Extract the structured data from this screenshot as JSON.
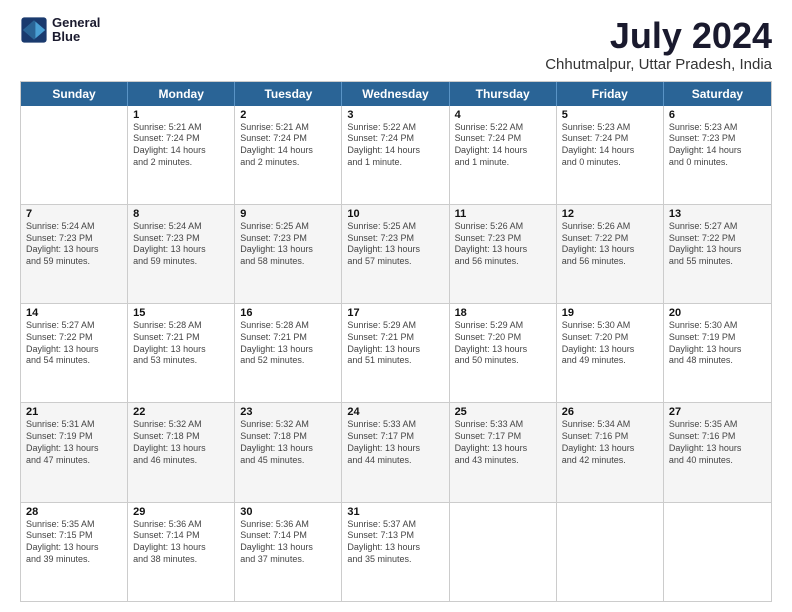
{
  "header": {
    "logo": {
      "line1": "General",
      "line2": "Blue"
    },
    "title": "July 2024",
    "subtitle": "Chhutmalpur, Uttar Pradesh, India"
  },
  "calendar": {
    "days_of_week": [
      "Sunday",
      "Monday",
      "Tuesday",
      "Wednesday",
      "Thursday",
      "Friday",
      "Saturday"
    ],
    "rows": [
      {
        "cells": [
          {
            "day": "",
            "info": ""
          },
          {
            "day": "1",
            "info": "Sunrise: 5:21 AM\nSunset: 7:24 PM\nDaylight: 14 hours\nand 2 minutes."
          },
          {
            "day": "2",
            "info": "Sunrise: 5:21 AM\nSunset: 7:24 PM\nDaylight: 14 hours\nand 2 minutes."
          },
          {
            "day": "3",
            "info": "Sunrise: 5:22 AM\nSunset: 7:24 PM\nDaylight: 14 hours\nand 1 minute."
          },
          {
            "day": "4",
            "info": "Sunrise: 5:22 AM\nSunset: 7:24 PM\nDaylight: 14 hours\nand 1 minute."
          },
          {
            "day": "5",
            "info": "Sunrise: 5:23 AM\nSunset: 7:24 PM\nDaylight: 14 hours\nand 0 minutes."
          },
          {
            "day": "6",
            "info": "Sunrise: 5:23 AM\nSunset: 7:23 PM\nDaylight: 14 hours\nand 0 minutes."
          }
        ]
      },
      {
        "cells": [
          {
            "day": "7",
            "info": "Sunrise: 5:24 AM\nSunset: 7:23 PM\nDaylight: 13 hours\nand 59 minutes."
          },
          {
            "day": "8",
            "info": "Sunrise: 5:24 AM\nSunset: 7:23 PM\nDaylight: 13 hours\nand 59 minutes."
          },
          {
            "day": "9",
            "info": "Sunrise: 5:25 AM\nSunset: 7:23 PM\nDaylight: 13 hours\nand 58 minutes."
          },
          {
            "day": "10",
            "info": "Sunrise: 5:25 AM\nSunset: 7:23 PM\nDaylight: 13 hours\nand 57 minutes."
          },
          {
            "day": "11",
            "info": "Sunrise: 5:26 AM\nSunset: 7:23 PM\nDaylight: 13 hours\nand 56 minutes."
          },
          {
            "day": "12",
            "info": "Sunrise: 5:26 AM\nSunset: 7:22 PM\nDaylight: 13 hours\nand 56 minutes."
          },
          {
            "day": "13",
            "info": "Sunrise: 5:27 AM\nSunset: 7:22 PM\nDaylight: 13 hours\nand 55 minutes."
          }
        ]
      },
      {
        "cells": [
          {
            "day": "14",
            "info": "Sunrise: 5:27 AM\nSunset: 7:22 PM\nDaylight: 13 hours\nand 54 minutes."
          },
          {
            "day": "15",
            "info": "Sunrise: 5:28 AM\nSunset: 7:21 PM\nDaylight: 13 hours\nand 53 minutes."
          },
          {
            "day": "16",
            "info": "Sunrise: 5:28 AM\nSunset: 7:21 PM\nDaylight: 13 hours\nand 52 minutes."
          },
          {
            "day": "17",
            "info": "Sunrise: 5:29 AM\nSunset: 7:21 PM\nDaylight: 13 hours\nand 51 minutes."
          },
          {
            "day": "18",
            "info": "Sunrise: 5:29 AM\nSunset: 7:20 PM\nDaylight: 13 hours\nand 50 minutes."
          },
          {
            "day": "19",
            "info": "Sunrise: 5:30 AM\nSunset: 7:20 PM\nDaylight: 13 hours\nand 49 minutes."
          },
          {
            "day": "20",
            "info": "Sunrise: 5:30 AM\nSunset: 7:19 PM\nDaylight: 13 hours\nand 48 minutes."
          }
        ]
      },
      {
        "cells": [
          {
            "day": "21",
            "info": "Sunrise: 5:31 AM\nSunset: 7:19 PM\nDaylight: 13 hours\nand 47 minutes."
          },
          {
            "day": "22",
            "info": "Sunrise: 5:32 AM\nSunset: 7:18 PM\nDaylight: 13 hours\nand 46 minutes."
          },
          {
            "day": "23",
            "info": "Sunrise: 5:32 AM\nSunset: 7:18 PM\nDaylight: 13 hours\nand 45 minutes."
          },
          {
            "day": "24",
            "info": "Sunrise: 5:33 AM\nSunset: 7:17 PM\nDaylight: 13 hours\nand 44 minutes."
          },
          {
            "day": "25",
            "info": "Sunrise: 5:33 AM\nSunset: 7:17 PM\nDaylight: 13 hours\nand 43 minutes."
          },
          {
            "day": "26",
            "info": "Sunrise: 5:34 AM\nSunset: 7:16 PM\nDaylight: 13 hours\nand 42 minutes."
          },
          {
            "day": "27",
            "info": "Sunrise: 5:35 AM\nSunset: 7:16 PM\nDaylight: 13 hours\nand 40 minutes."
          }
        ]
      },
      {
        "cells": [
          {
            "day": "28",
            "info": "Sunrise: 5:35 AM\nSunset: 7:15 PM\nDaylight: 13 hours\nand 39 minutes."
          },
          {
            "day": "29",
            "info": "Sunrise: 5:36 AM\nSunset: 7:14 PM\nDaylight: 13 hours\nand 38 minutes."
          },
          {
            "day": "30",
            "info": "Sunrise: 5:36 AM\nSunset: 7:14 PM\nDaylight: 13 hours\nand 37 minutes."
          },
          {
            "day": "31",
            "info": "Sunrise: 5:37 AM\nSunset: 7:13 PM\nDaylight: 13 hours\nand 35 minutes."
          },
          {
            "day": "",
            "info": ""
          },
          {
            "day": "",
            "info": ""
          },
          {
            "day": "",
            "info": ""
          }
        ]
      }
    ]
  }
}
